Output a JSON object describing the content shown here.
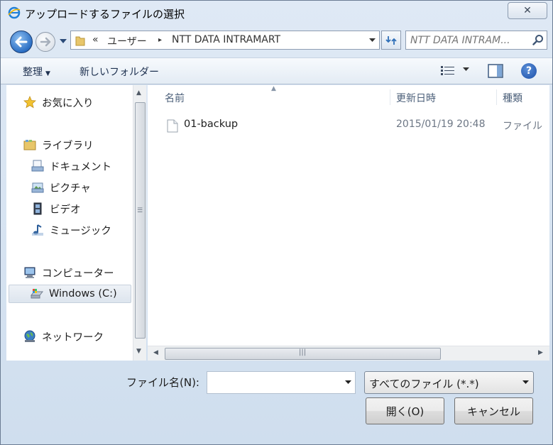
{
  "window": {
    "title": "アップロードするファイルの選択",
    "close_label": "✕"
  },
  "nav": {
    "back_icon": "back-arrow-icon",
    "forward_icon": "forward-arrow-icon",
    "breadcrumb": {
      "overflow": "«",
      "user": "ユーザー",
      "separator": "▸",
      "current": "NTT DATA INTRAMART"
    },
    "search_placeholder": "NTT DATA INTRAM..."
  },
  "toolbar": {
    "organize_label": "整理",
    "new_folder_label": "新しいフォルダー",
    "help_label": "?"
  },
  "sidebar": {
    "favorites": "お気に入り",
    "libraries": "ライブラリ",
    "library_items": [
      "ドキュメント",
      "ピクチャ",
      "ビデオ",
      "ミュージック"
    ],
    "computer": "コンピューター",
    "drive": "Windows (C:)",
    "network": "ネットワーク"
  },
  "file_list": {
    "columns": {
      "name": "名前",
      "date": "更新日時",
      "type": "種類"
    },
    "rows": [
      {
        "name": "01-backup",
        "date": "2015/01/19 20:48",
        "type": "ファイル"
      }
    ]
  },
  "footer": {
    "filename_label": "ファイル名(N):",
    "filename_value": "",
    "filetype_selected": "すべてのファイル (*.*)",
    "open_label": "開く(O)",
    "cancel_label": "キャンセル"
  },
  "colors": {
    "window_bg": "#d6e3f1",
    "accent": "#2c6fc4"
  }
}
